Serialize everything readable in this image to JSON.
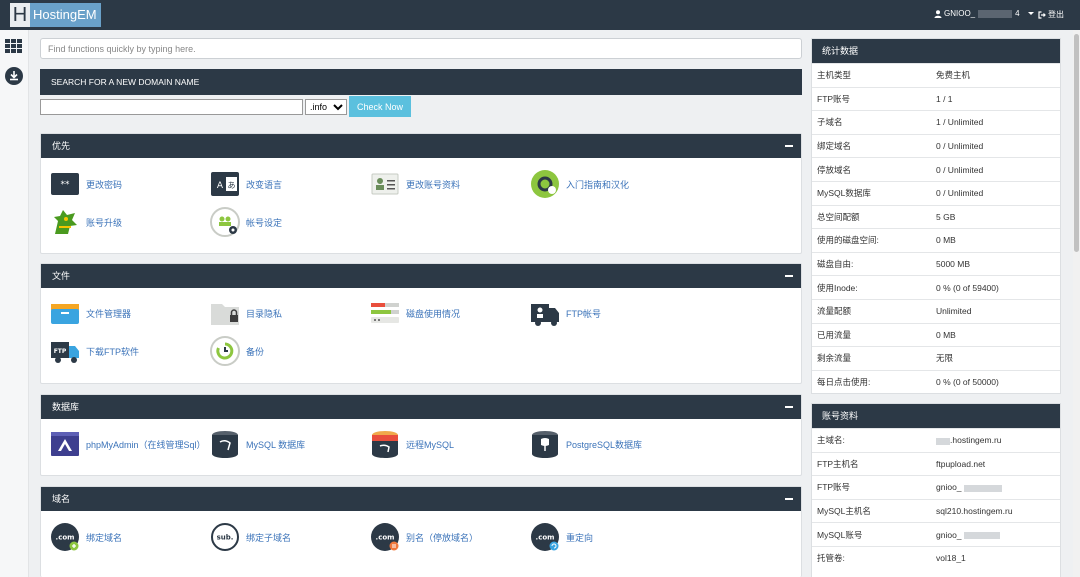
{
  "topbar": {
    "logo_letter": "H",
    "logo_text": "HostingEM",
    "user_prefix": "GNIOO_",
    "user_suffix": "4",
    "logout_label": "登出"
  },
  "search": {
    "placeholder": "Find functions quickly by typing here."
  },
  "domain_search": {
    "title": "SEARCH FOR A NEW DOMAIN NAME",
    "input_value": "",
    "tld": ".info",
    "button_label": "Check Now"
  },
  "sections": [
    {
      "title": "优先",
      "items": [
        {
          "label": "更改密码",
          "icon": "password-icon"
        },
        {
          "label": "改变语言",
          "icon": "language-icon"
        },
        {
          "label": "更改账号资料",
          "icon": "account-card-icon"
        },
        {
          "label": "入门指南和汉化",
          "icon": "getting-started-icon"
        },
        {
          "label": "账号升级",
          "icon": "upgrade-dragon-icon"
        },
        {
          "label": "帐号设定",
          "icon": "account-settings-icon"
        }
      ]
    },
    {
      "title": "文件",
      "items": [
        {
          "label": "文件管理器",
          "icon": "file-manager-icon"
        },
        {
          "label": "目录隐私",
          "icon": "directory-privacy-icon"
        },
        {
          "label": "磁盘使用情况",
          "icon": "disk-usage-icon"
        },
        {
          "label": "FTP帐号",
          "icon": "ftp-account-icon"
        },
        {
          "label": "下载FTP软件",
          "icon": "ftp-download-icon"
        },
        {
          "label": "备份",
          "icon": "backup-icon"
        }
      ]
    },
    {
      "title": "数据库",
      "items": [
        {
          "label": "phpMyAdmin（在线管理Sql）",
          "icon": "phpmyadmin-icon"
        },
        {
          "label": "MySQL 数据库",
          "icon": "mysql-database-icon"
        },
        {
          "label": "远程MySQL",
          "icon": "remote-mysql-icon"
        },
        {
          "label": "PostgreSQL数据库",
          "icon": "postgresql-icon"
        }
      ]
    },
    {
      "title": "域名",
      "items": [
        {
          "label": "绑定域名",
          "icon": "addon-domain-icon",
          "glyph": ".com"
        },
        {
          "label": "绑定子域名",
          "icon": "subdomain-icon",
          "glyph": "sub."
        },
        {
          "label": "别名（停放域名）",
          "icon": "parked-domain-icon",
          "glyph": ".com"
        },
        {
          "label": "重定向",
          "icon": "redirect-icon",
          "glyph": ".com"
        }
      ]
    }
  ],
  "stats": {
    "title": "统计数据",
    "rows": [
      {
        "k": "主机类型",
        "v": "免费主机"
      },
      {
        "k": "FTP账号",
        "v": "1 / 1"
      },
      {
        "k": "子域名",
        "v": "1 / Unlimited"
      },
      {
        "k": "绑定域名",
        "v": "0 / Unlimited"
      },
      {
        "k": "停放域名",
        "v": "0 / Unlimited"
      },
      {
        "k": "MySQL数据库",
        "v": "0 / Unlimited"
      },
      {
        "k": "总空间配额",
        "v": "5 GB"
      },
      {
        "k": "使用的磁盘空间:",
        "v": "0 MB"
      },
      {
        "k": "磁盘自由:",
        "v": "5000 MB"
      },
      {
        "k": "使用Inode:",
        "v": "0 % (0 of 59400)"
      },
      {
        "k": "流量配额",
        "v": "Unlimited"
      },
      {
        "k": "已用流量",
        "v": "0 MB"
      },
      {
        "k": "剩余流量",
        "v": "无限"
      },
      {
        "k": "每日点击使用:",
        "v": "0 % (0 of 50000)"
      }
    ]
  },
  "account": {
    "title": "账号资料",
    "rows": [
      {
        "k": "主域名:",
        "v": ".hostingem.ru"
      },
      {
        "k": "FTP主机名",
        "v": "ftpupload.net"
      },
      {
        "k": "FTP账号",
        "v": "gnioo_"
      },
      {
        "k": "MySQL主机名",
        "v": "sql210.hostingem.ru"
      },
      {
        "k": "MySQL账号",
        "v": "gnioo_"
      },
      {
        "k": "托管卷:",
        "v": "vol18_1"
      }
    ]
  },
  "colors": {
    "header": "#2c3946",
    "link": "#3b73b9",
    "button": "#5bc0de"
  }
}
